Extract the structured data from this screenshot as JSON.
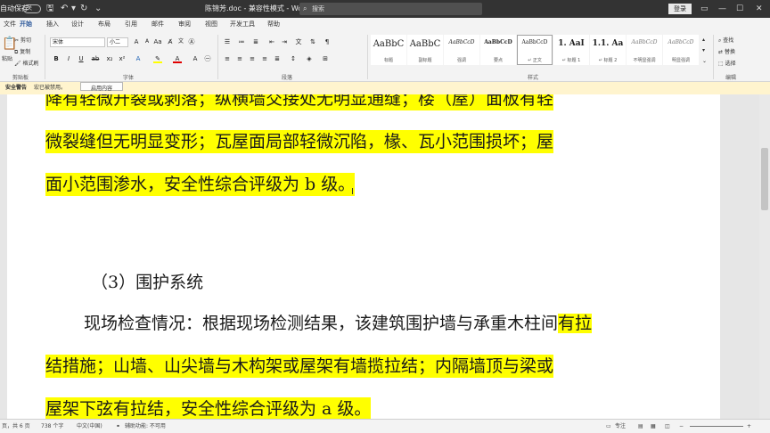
{
  "titlebar": {
    "autosave": "自动保存",
    "toggle": "关",
    "doc_title": "陈锦芳.doc  -  兼容性模式  -  Word Preview",
    "search_placeholder": "搜索",
    "login": "登录"
  },
  "menu": {
    "items": [
      "文件",
      "开始",
      "插入",
      "设计",
      "布局",
      "引用",
      "邮件",
      "审阅",
      "视图",
      "开发工具",
      "帮助"
    ]
  },
  "ribbon": {
    "clipboard": {
      "paste": "粘贴",
      "cut": "剪切",
      "copy": "复制",
      "format_painter": "格式刷",
      "label": "剪贴板"
    },
    "font": {
      "name": "宋体",
      "size": "小二",
      "label": "字体"
    },
    "paragraph": {
      "label": "段落"
    },
    "styles": {
      "label": "样式",
      "items": [
        {
          "sample": "AaBbC",
          "name": "标题"
        },
        {
          "sample": "AaBbC",
          "name": "副标题"
        },
        {
          "sample": "AaBbCcD",
          "name": "强调"
        },
        {
          "sample": "AaBbCcD",
          "name": "要点"
        },
        {
          "sample": "AaBbCcD",
          "name": "↵ 正文"
        },
        {
          "sample": "1. AaI",
          "name": "↵ 标题 1"
        },
        {
          "sample": "1.1. Aa",
          "name": "↵ 标题 2"
        },
        {
          "sample": "AaBbCcD",
          "name": "不明显强调"
        },
        {
          "sample": "AaBbCcD",
          "name": "明显强调"
        }
      ]
    },
    "editing": {
      "find": "查找",
      "replace": "替换",
      "select": "选择",
      "label": "编辑"
    }
  },
  "message_bar": {
    "title": "安全警告",
    "text": "宏已被禁用。",
    "button": "启用内容"
  },
  "document": {
    "lines": [
      {
        "text": "降有轻微开裂或剥落；纵横墙交接处无明显通缝；楼（屋）面板有轻",
        "highlight": true
      },
      {
        "text": "微裂缝但无明显变形；瓦屋面局部轻微沉陷，椽、瓦小范围损坏；屋",
        "highlight": true
      },
      {
        "text": "面小范围渗水，安全性综合评级为 b 级。",
        "highlight": true
      },
      {
        "text": "（3）围护系统",
        "highlight": false
      },
      {
        "text_plain": "现场检查情况：根据现场检测结果，该建筑围护墙与承重木柱间",
        "text_hl": "有拉"
      },
      {
        "text": "结措施；山墙、山尖墙与木构架或屋架有墙揽拉结；内隔墙顶与梁或",
        "highlight": true
      },
      {
        "text": "屋架下弦有拉结，安全性综合评级为 a 级。",
        "highlight": true
      }
    ]
  },
  "statusbar": {
    "page": "页，共 6 页",
    "words": "738 个字",
    "language": "中文(中国)",
    "accessibility": "辅助功能: 不可用",
    "focus": "专注"
  }
}
